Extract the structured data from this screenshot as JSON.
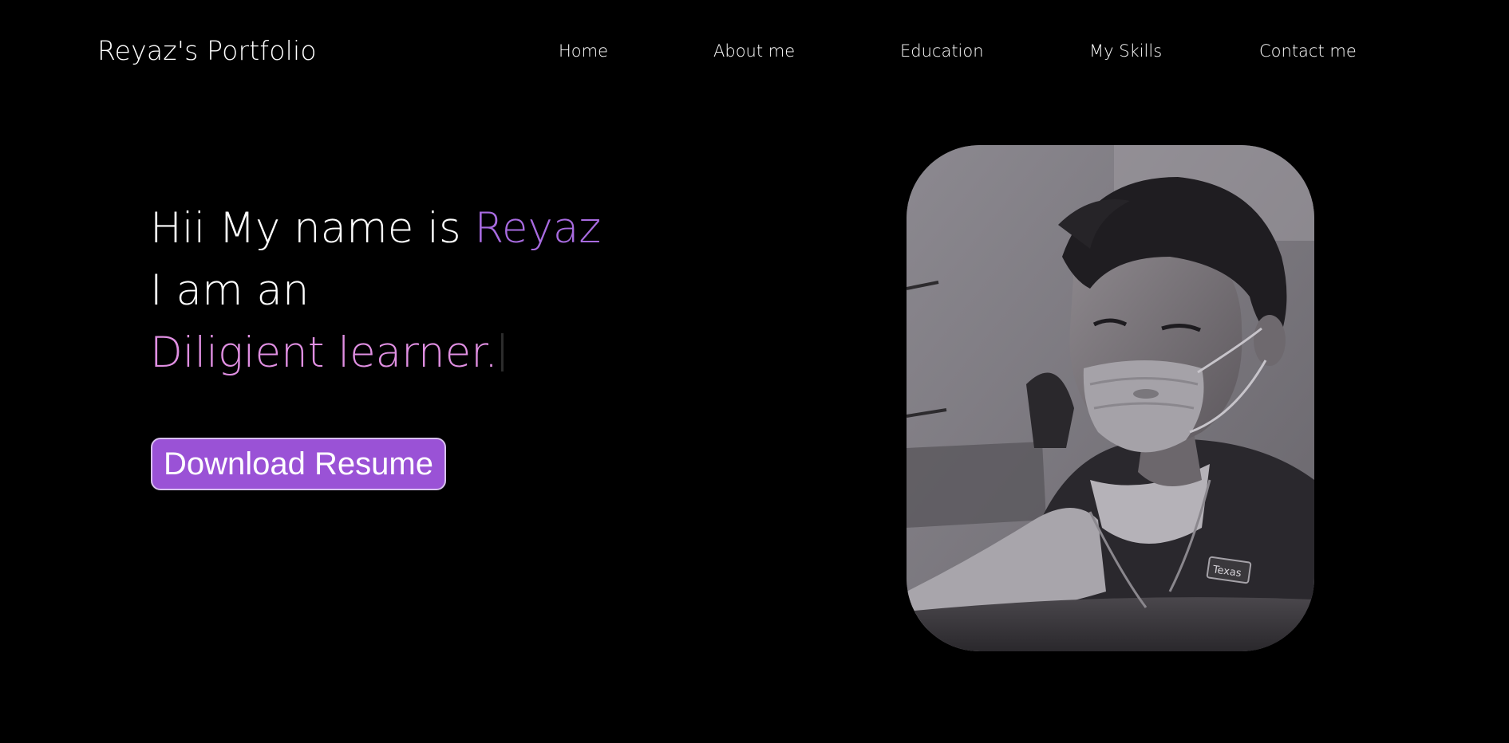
{
  "header": {
    "brand": "Reyaz's Portfolio",
    "nav": [
      {
        "label": "Home"
      },
      {
        "label": "About me"
      },
      {
        "label": "Education"
      },
      {
        "label": "My Skills"
      },
      {
        "label": "Contact me"
      }
    ]
  },
  "hero": {
    "intro_prefix": "Hii My name is ",
    "name": "Reyaz",
    "line2": "I am an",
    "role": "Diligient learner."
  },
  "cta": {
    "download_label": "Download Resume"
  },
  "photo": {
    "badge_text": "Texas"
  },
  "colors": {
    "background": "#000000",
    "name_accent": "#a86be0",
    "role_accent": "#e08fe2",
    "button_bg": "#9a52d6",
    "button_border": "#d8c0ee"
  }
}
